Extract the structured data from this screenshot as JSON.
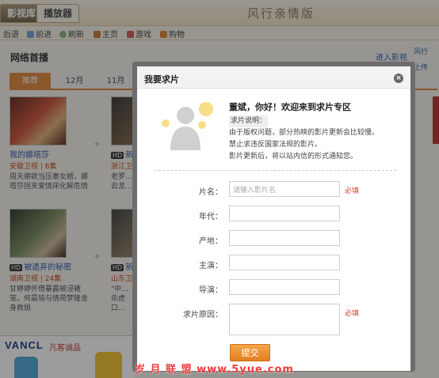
{
  "header": {
    "tabs": [
      "影视库",
      "播放器"
    ],
    "brand": "风行亲情版"
  },
  "nav": {
    "items": [
      {
        "label": "后退",
        "icon": "back-icon"
      },
      {
        "label": "前进",
        "icon": "forward-icon"
      },
      {
        "label": "刷新",
        "icon": "refresh-icon"
      },
      {
        "label": "主页",
        "icon": "home-icon"
      },
      {
        "label": "游戏",
        "icon": "game-icon"
      },
      {
        "label": "购物",
        "icon": "cart-icon"
      }
    ]
  },
  "main": {
    "section_title": "网络首播",
    "enter_link": "进入影视",
    "tabs": [
      "推荐",
      "12月",
      "11月"
    ],
    "cards": [
      {
        "title": "我的娜塔莎",
        "meta": "安徽卫视 | 6集",
        "desc": "周天德欲当压寨女婿，娜塔莎拐夹爱情床化解危情",
        "hd": ""
      },
      {
        "title": "新…",
        "meta": "浙江卫视 | 3…",
        "desc": "老罗…云龙…",
        "hd": "HD"
      },
      {
        "title": "被遗弃的秘密",
        "meta": "湖南卫视 | 24集",
        "desc": "甘婷婷怀借暴露被浸猪笼，何晨铭与情荷梦隆舍身救姐",
        "hd": "HD"
      },
      {
        "title": "新…",
        "meta": "山东卫视…",
        "desc": "\"中…杀虎口…",
        "hd": "HD"
      }
    ],
    "right_strip": [
      "风行",
      "上传"
    ],
    "ad": {
      "brand": "VANCL",
      "slogan": "凡客诚品"
    }
  },
  "modal": {
    "title": "我要求片",
    "close": "×",
    "welcome": "董斌，你好！欢迎来到求片专区",
    "note_label": "求片说明：",
    "note_lines": [
      "由于版权问题，部分热映的影片更新会比较慢。",
      "禁止求违反国家法规的影片。",
      "影片更新后，将以站内信的形式通知您。"
    ],
    "fields": {
      "name": {
        "label": "片名：",
        "placeholder": "请输入影片名",
        "required": "必填"
      },
      "year": {
        "label": "年代："
      },
      "region": {
        "label": "产地："
      },
      "actor": {
        "label": "主演："
      },
      "director": {
        "label": "导演："
      },
      "reason": {
        "label": "求片原因：",
        "required": "必填"
      }
    },
    "submit": "提交"
  },
  "watermark": "岁 月 联 盟  www.5yue.com"
}
